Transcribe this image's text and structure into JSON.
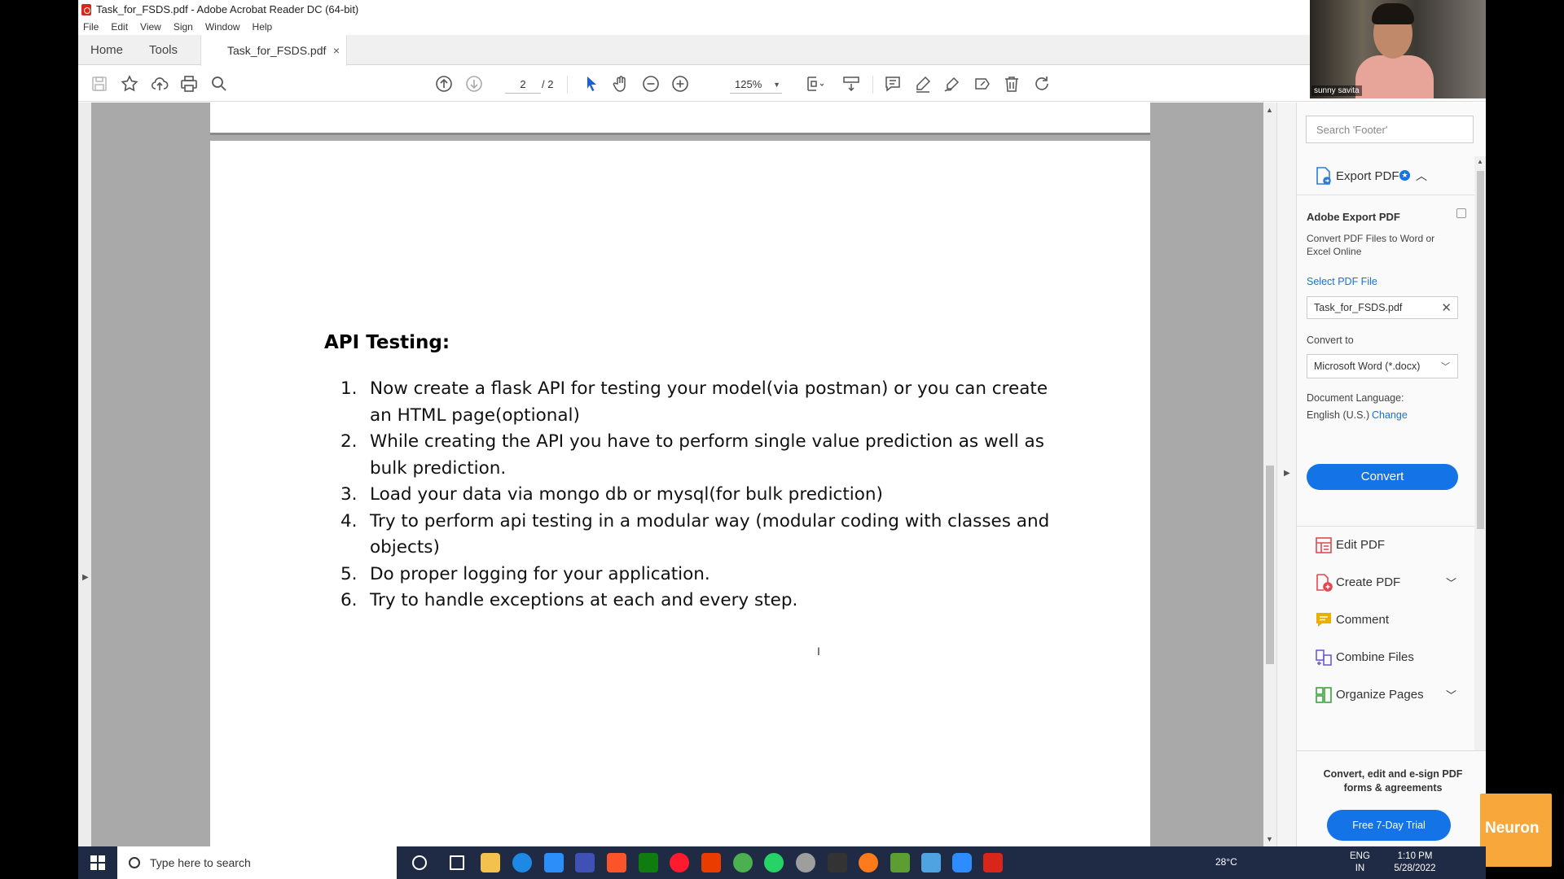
{
  "window": {
    "title": "Task_for_FSDS.pdf - Adobe Acrobat Reader DC (64-bit)"
  },
  "menu": [
    "File",
    "Edit",
    "View",
    "Sign",
    "Window",
    "Help"
  ],
  "tabs": {
    "home": "Home",
    "tools": "Tools",
    "document": "Task_for_FSDS.pdf",
    "close_glyph": "×"
  },
  "toolbar": {
    "page_current": "2",
    "page_total": "/ 2",
    "zoom": "125%"
  },
  "document": {
    "heading": "API Testing:",
    "items": [
      {
        "num": "1.",
        "text": "Now create a flask API for testing your model(via postman) or you can create an HTML page(optional)"
      },
      {
        "num": "2.",
        "text": "While creating the API you have to perform single value prediction as well as bulk prediction."
      },
      {
        "num": "3.",
        "text": "Load your data via mongo db or mysql(for bulk prediction)"
      },
      {
        "num": "4.",
        "text": "Try to perform api testing in a modular way (modular coding with classes and objects)"
      },
      {
        "num": "5.",
        "text": "Do proper logging for your application."
      },
      {
        "num": "6.",
        "text": "Try to handle exceptions at each and every step."
      }
    ]
  },
  "right_pane": {
    "search_placeholder": "Search 'Footer'",
    "export": {
      "label": "Export PDF",
      "title": "Adobe Export PDF",
      "description": "Convert PDF Files to Word or Excel Online",
      "select_link": "Select PDF File",
      "file_name": "Task_for_FSDS.pdf",
      "convert_to_label": "Convert to",
      "convert_to_value": "Microsoft Word (*.docx)",
      "language_label": "Document Language:",
      "language_value": "English (U.S.)",
      "language_change": "Change",
      "convert_button": "Convert"
    },
    "tools": [
      {
        "label": "Edit PDF",
        "icon": "edit-pdf-icon",
        "color": "#e34850",
        "has_chevron": false
      },
      {
        "label": "Create PDF",
        "icon": "create-pdf-icon",
        "color": "#e34850",
        "has_chevron": true
      },
      {
        "label": "Comment",
        "icon": "comment-icon",
        "color": "#e8b100",
        "has_chevron": false
      },
      {
        "label": "Combine Files",
        "icon": "combine-files-icon",
        "color": "#6e5ed6",
        "has_chevron": false
      },
      {
        "label": "Organize Pages",
        "icon": "organize-pages-icon",
        "color": "#3ca63c",
        "has_chevron": true
      }
    ],
    "promo_text": "Convert, edit and e-sign PDF forms & agreements",
    "promo_button": "Free 7-Day Trial"
  },
  "webcam": {
    "name": "sunny savita"
  },
  "overlay_logo": "Neuron",
  "taskbar": {
    "search_placeholder": "Type here to search",
    "temperature": "28°C",
    "lang_line1": "ENG",
    "lang_line2": "IN",
    "time": "1:10 PM",
    "date": "5/28/2022"
  },
  "colors": {
    "accent": "#1473e6",
    "acrobat_red": "#d8261b",
    "doc_background": "#a9a9a9",
    "taskbar": "#1f2a44"
  }
}
